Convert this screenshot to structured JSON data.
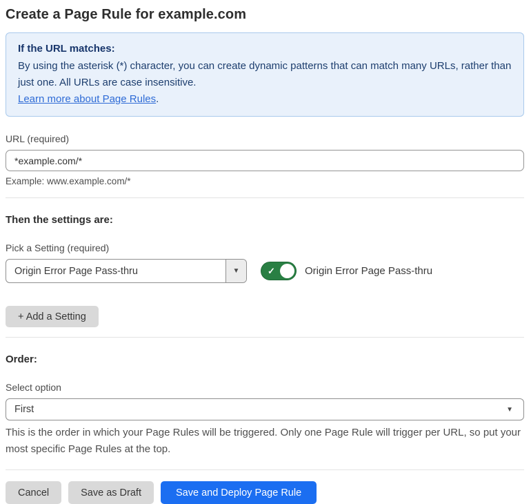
{
  "page": {
    "title": "Create a Page Rule for example.com"
  },
  "info_box": {
    "heading": "If the URL matches:",
    "body": "By using the asterisk (*) character, you can create dynamic patterns that can match many URLs, rather than just one. All URLs are case insensitive.",
    "link_label": "Learn more about Page Rules",
    "link_suffix": "."
  },
  "url_field": {
    "label": "URL (required)",
    "value": "*example.com/*",
    "helper": "Example: www.example.com/*"
  },
  "settings_section": {
    "heading": "Then the settings are:",
    "picker_label": "Pick a Setting (required)",
    "picker_value": "Origin Error Page Pass-thru",
    "toggle_state": "on",
    "toggle_label": "Origin Error Page Pass-thru",
    "add_button_label": "+ Add a Setting"
  },
  "order_section": {
    "heading": "Order:",
    "select_label": "Select option",
    "select_value": "First",
    "helper": "This is the order in which your Page Rules will be triggered. Only one Page Rule will trigger per URL, so put your most specific Page Rules at the top."
  },
  "footer": {
    "cancel_label": "Cancel",
    "save_draft_label": "Save as Draft",
    "save_deploy_label": "Save and Deploy Page Rule"
  },
  "icons": {
    "dropdown_arrow": "▼",
    "check": "✓"
  },
  "colors": {
    "accent_blue": "#1b6ef1",
    "toggle_green": "#297f43",
    "info_box_bg": "#e9f1fb",
    "info_box_border": "#a9c9ec",
    "info_text": "#1d3e6e",
    "link_blue": "#2e6bd6",
    "gray_button_bg": "#d9d9d9"
  }
}
